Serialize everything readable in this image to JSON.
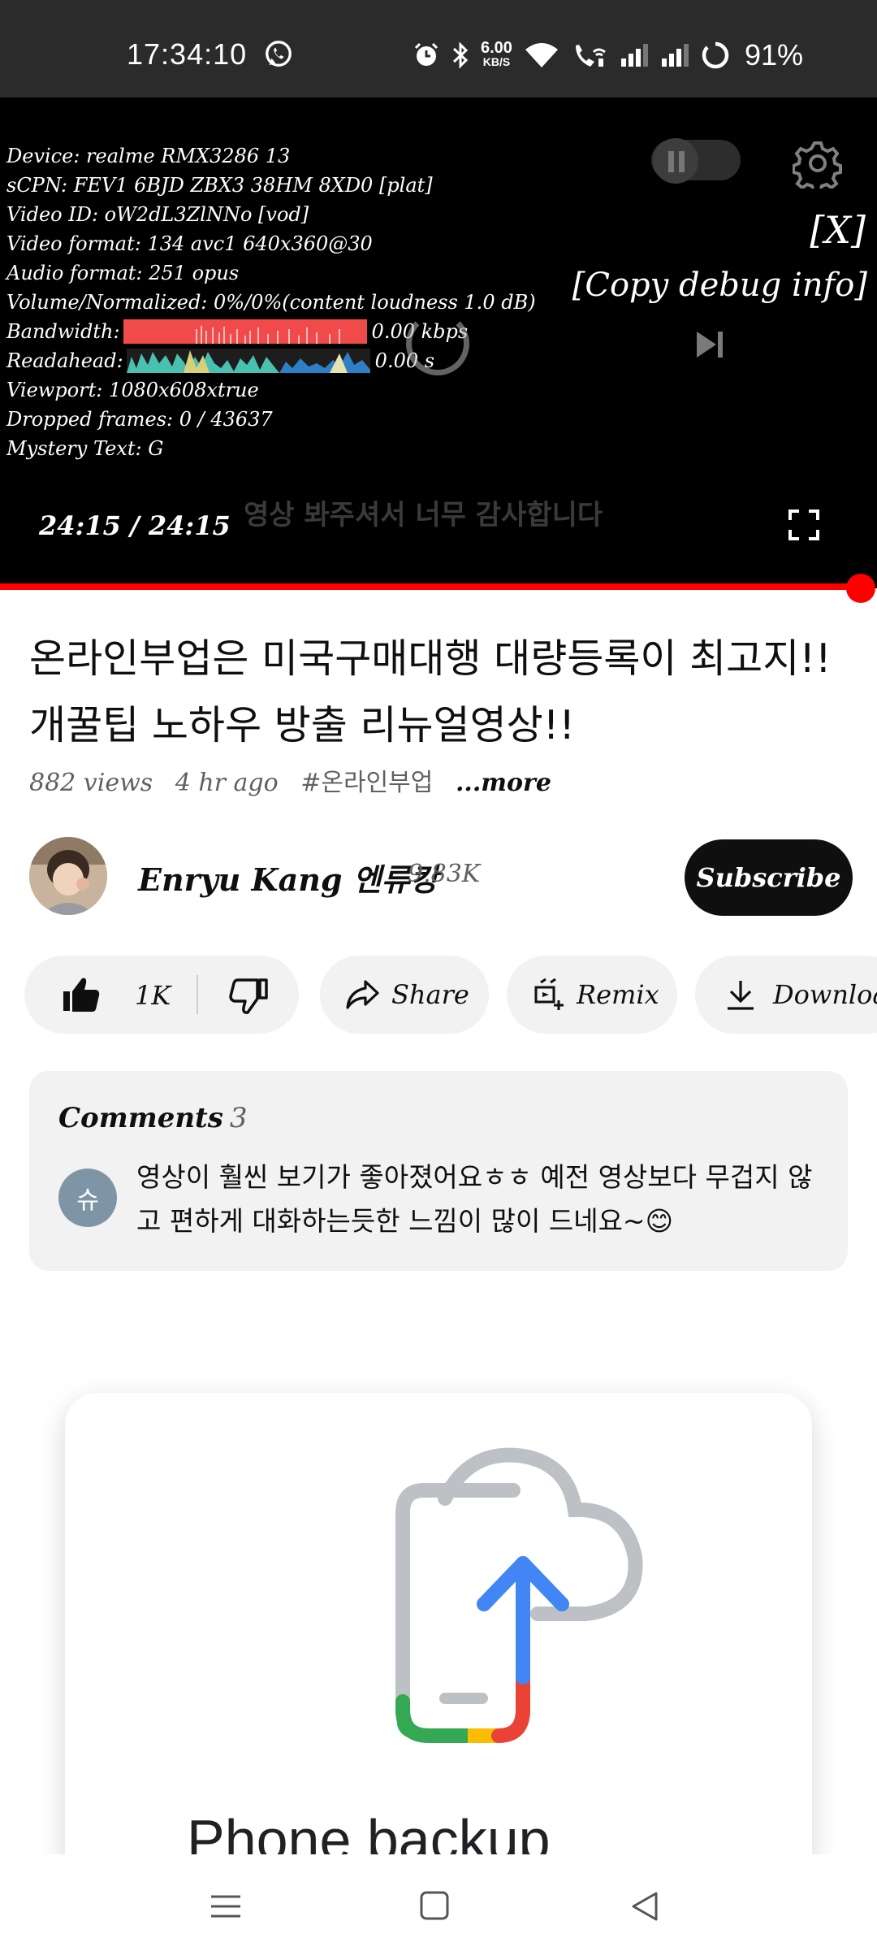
{
  "status_bar": {
    "time": "17:34:10",
    "net_speed": "6.00",
    "net_unit": "KB/S",
    "battery": "91%",
    "icons": [
      "whatsapp-icon",
      "alarm-icon",
      "bluetooth-icon",
      "wifi-icon",
      "wifi-calling-icon",
      "signal-icon",
      "signal-icon",
      "battery-icon"
    ]
  },
  "player": {
    "debug": {
      "device": "Device: realme RMX3286 13",
      "cpn": "sCPN: FEV1 6BJD ZBX3 38HM 8XD0 [plat]",
      "video_id": "Video ID: oW2dL3ZlNNo [vod]",
      "video_format": "Video format: 134 avc1 640x360@30",
      "audio_format": "Audio format: 251 opus",
      "volume": "Volume/Normalized: 0%/0%(content loudness 1.0 dB)",
      "bandwidth_label": "Bandwidth:",
      "bandwidth_value": "0.00 kbps",
      "readahead_label": "Readahead:",
      "readahead_value": "0.00 s",
      "viewport": "Viewport: 1080x608xtrue",
      "dropped_frames": "Dropped frames: 0 / 43637",
      "mystery_text": "Mystery Text: G"
    },
    "close_debug": "[X]",
    "copy_debug": "[Copy debug info]",
    "subtitle": "영상 봐주셔서 너무 감사합니다",
    "time_display": "24:15 / 24:15",
    "progress": 1.0,
    "accent_color": "#ff0000"
  },
  "video": {
    "title": "온라인부업은 미국구매대행 대량등록이 최고지!! 개꿀팁 노하우 방출 리뉴얼영상!!",
    "views": "882 views",
    "age": "4 hr ago",
    "hashtag": "#온라인부업",
    "more": "...more"
  },
  "channel": {
    "name": "Enryu Kang 엔류캉",
    "subscribers": "9.83K",
    "subscribe_label": "Subscribe"
  },
  "actions": {
    "likes": "1K",
    "share": "Share",
    "remix": "Remix",
    "download": "Download"
  },
  "comments": {
    "title": "Comments",
    "count": "3",
    "avatar_letter": "슈",
    "avatar_color": "#7e95a6",
    "text": "영상이 훨씬 보기가 좋아졌어요ㅎㅎ 예전 영상보다 무겁지 않고 편하게 대화하는듯한 느낌이 많이 드네요~😊"
  },
  "ad": {
    "title": "Phone backup"
  }
}
